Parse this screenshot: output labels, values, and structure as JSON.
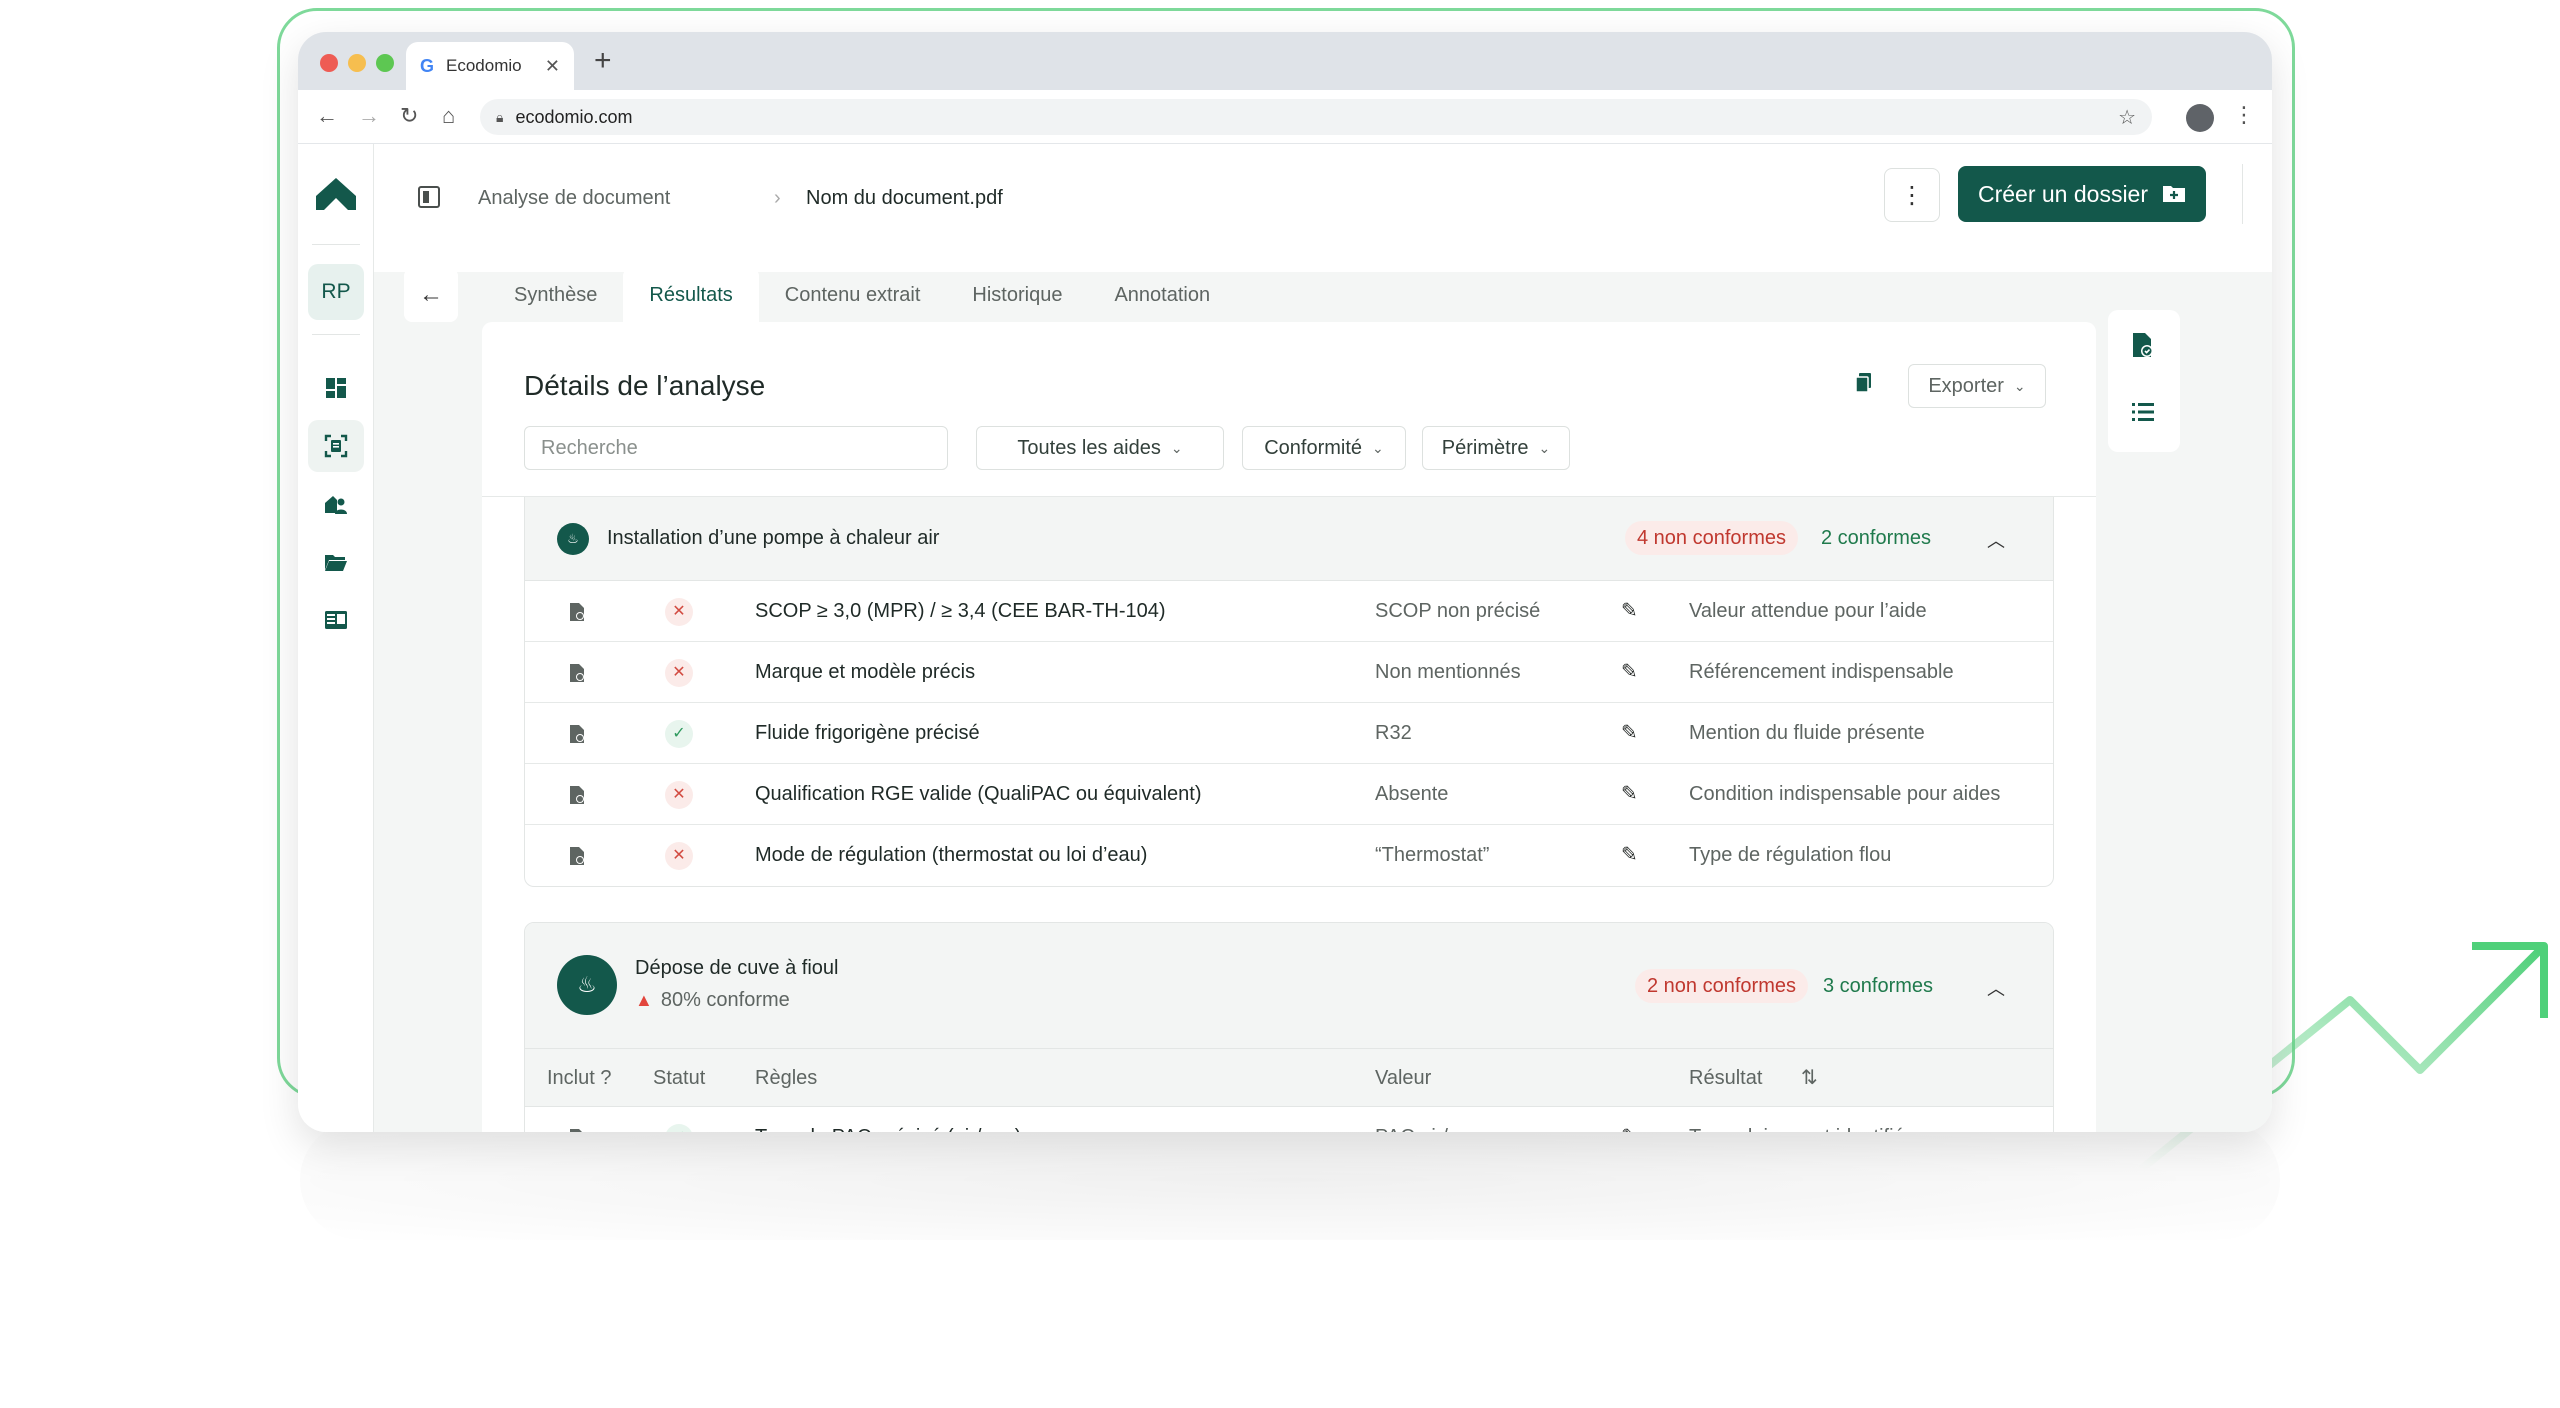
{
  "browser": {
    "tab_title": "Ecodomio",
    "tab_favicon": "G",
    "url": "ecodomio.com"
  },
  "sidebar": {
    "avatar": "RP",
    "items": [
      {
        "icon": "dashboard-icon"
      },
      {
        "icon": "document-scan-icon",
        "active": true
      },
      {
        "icon": "user-house-icon"
      },
      {
        "icon": "folder-icon"
      },
      {
        "icon": "table-icon"
      }
    ]
  },
  "topbar": {
    "breadcrumb_parent": "Analyse de document",
    "breadcrumb_current": "Nom du document.pdf",
    "create_label": "Créer un dossier"
  },
  "tabs": [
    {
      "label": "Synthèse",
      "active": false
    },
    {
      "label": "Résultats",
      "active": true
    },
    {
      "label": "Contenu extrait",
      "active": false
    },
    {
      "label": "Historique",
      "active": false
    },
    {
      "label": "Annotation",
      "active": false
    }
  ],
  "details": {
    "title": "Détails de l’analyse",
    "export_label": "Exporter",
    "search_placeholder": "Recherche",
    "filters": [
      "Toutes les aides",
      "Conformité",
      "Périmètre"
    ]
  },
  "sections": [
    {
      "name": "Installation d’une pompe à chaleur air",
      "non_conformes": "4 non conformes",
      "conformes": "2 conformes",
      "rows": [
        {
          "status": "ko",
          "rule": "SCOP ≥ 3,0 (MPR) / ≥ 3,4 (CEE BAR-TH-104)",
          "value": "SCOP non précisé",
          "result": "Valeur attendue pour l’aide"
        },
        {
          "status": "ko",
          "rule": "Marque et modèle précis",
          "value": "Non mentionnés",
          "result": "Référencement indispensable"
        },
        {
          "status": "ok",
          "rule": "Fluide frigorigène précisé",
          "value": "R32",
          "result": "Mention du fluide présente"
        },
        {
          "status": "ko",
          "rule": "Qualification RGE valide (QualiPAC ou équivalent)",
          "value": "Absente",
          "result": "Condition indispensable pour aides"
        },
        {
          "status": "ko",
          "rule": "Mode de régulation (thermostat ou loi d’eau)",
          "value": "“Thermostat”",
          "result": "Type de régulation flou"
        }
      ]
    },
    {
      "name": "Dépose de cuve à fioul",
      "subtitle": "80% conforme",
      "non_conformes": "2 non conformes",
      "conformes": "3 conformes",
      "columns": {
        "inclut": "Inclut ?",
        "statut": "Statut",
        "regles": "Règles",
        "valeur": "Valeur",
        "resultat": "Résultat"
      },
      "rows": [
        {
          "status": "ok",
          "rule": "Type de PAC précisé (air/eau)",
          "value": "PAC air/eau",
          "result": "Type clairement identifié"
        }
      ]
    }
  ],
  "colors": {
    "brand": "#13584b",
    "danger": "#c0382f",
    "success": "#1f7a4c",
    "deco_green": "#7ed99a"
  }
}
